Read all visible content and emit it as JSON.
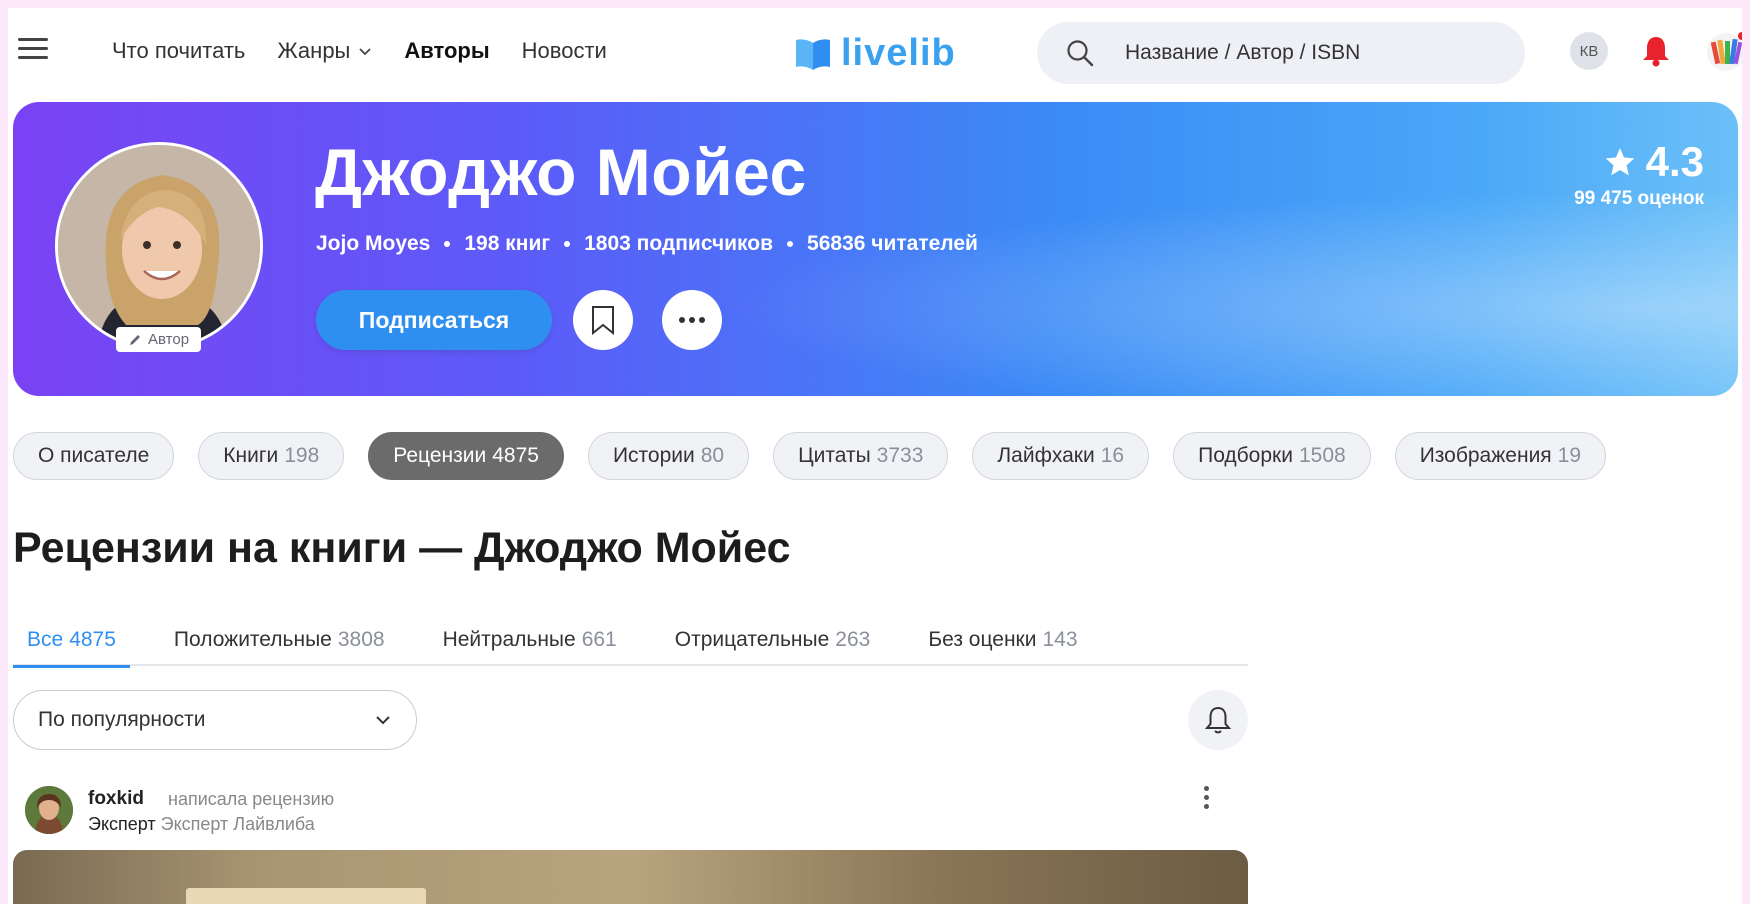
{
  "header": {
    "nav": [
      {
        "label": "Что почитать"
      },
      {
        "label": "Жанры"
      },
      {
        "label": "Авторы"
      },
      {
        "label": "Новости"
      }
    ],
    "logo_text": "livelib",
    "search_placeholder": "Название / Автор / ISBN",
    "user_initials": "КВ"
  },
  "author": {
    "name": "Джоджо Мойес",
    "original_name": "Jojo Moyes",
    "books": "198 книг",
    "subscribers": "1803 подписчиков",
    "readers": "56836 читателей",
    "badge": "Автор",
    "subscribe_label": "Подписаться",
    "rating": "4.3",
    "rating_count": "99 475 оценок"
  },
  "tabs": [
    {
      "label": "О писателе",
      "count": ""
    },
    {
      "label": "Книги",
      "count": "198"
    },
    {
      "label": "Рецензии",
      "count": "4875"
    },
    {
      "label": "Истории",
      "count": "80"
    },
    {
      "label": "Цитаты",
      "count": "3733"
    },
    {
      "label": "Лайфхаки",
      "count": "16"
    },
    {
      "label": "Подборки",
      "count": "1508"
    },
    {
      "label": "Изображения",
      "count": "19"
    }
  ],
  "page_title": "Рецензии на книги — Джоджо Мойес",
  "filters": [
    {
      "label": "Все",
      "count": "4875"
    },
    {
      "label": "Положительные",
      "count": "3808"
    },
    {
      "label": "Нейтральные",
      "count": "661"
    },
    {
      "label": "Отрицательные",
      "count": "263"
    },
    {
      "label": "Без оценки",
      "count": "143"
    }
  ],
  "sort": {
    "selected": "По популярности"
  },
  "review": {
    "user": "foxkid",
    "action": "написала рецензию",
    "role": "Эксперт",
    "role_detail": "Эксперт Лайвлиба"
  },
  "colors": {
    "accent": "#2f8ff0",
    "hero_start": "#7a42f4",
    "hero_end": "#6cc0f8",
    "notification": "#e8232e"
  }
}
